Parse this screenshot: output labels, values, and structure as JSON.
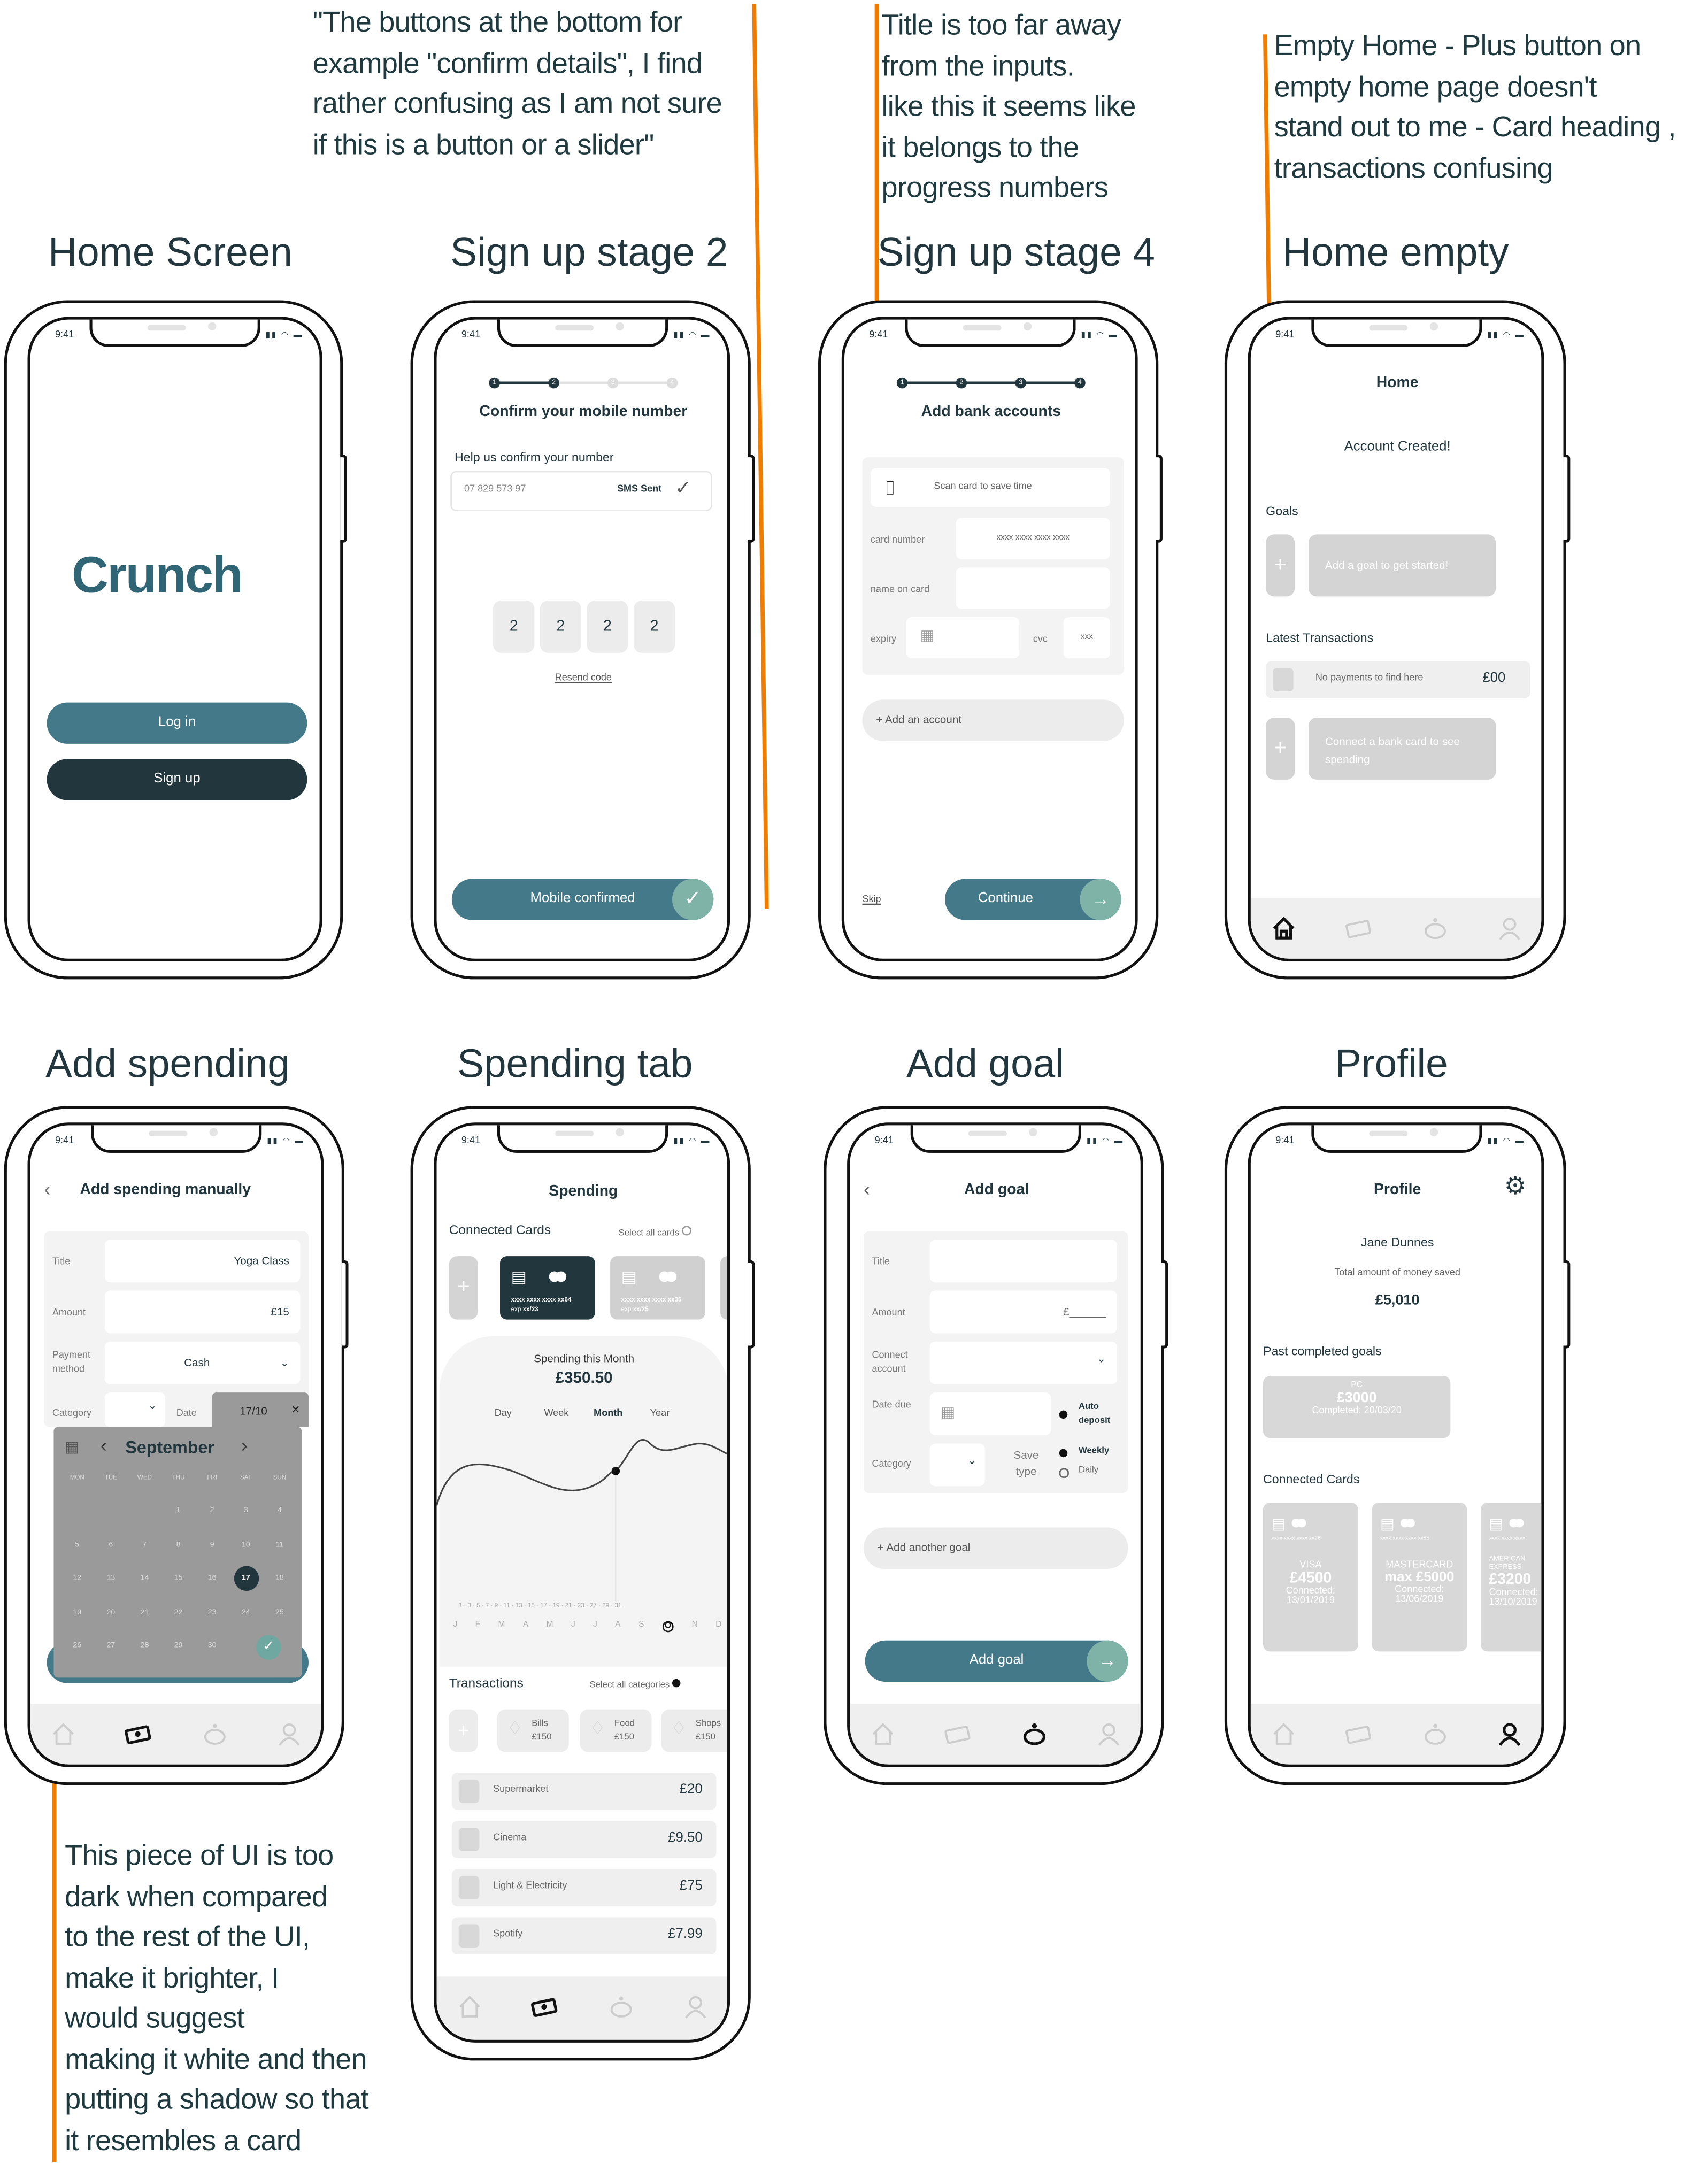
{
  "annotations": [
    {
      "lines": [
        "\"The buttons at the bottom for",
        "example \"confirm details\", I find",
        "rather confusing as I am not sure",
        "if this is a button or a slider\""
      ]
    },
    {
      "lines": [
        "Title is too far away",
        "from the inputs.",
        "like this it seems like",
        "it belongs to the",
        "progress numbers"
      ]
    },
    {
      "lines": [
        "Empty Home - Plus button on",
        "empty home page doesn't",
        "stand out to me - Card heading ,",
        "transactions confusing"
      ]
    },
    {
      "lines": [
        "This piece of UI is too",
        "dark when compared",
        "to the rest of the UI,",
        "make it brighter, I",
        "would suggest",
        "making it white and then",
        "putting a shadow so that",
        "it resembles a card"
      ]
    }
  ],
  "colors": {
    "accent": "#44798a",
    "dark": "#21363d",
    "annotation_line": "#f07d00",
    "placeholder": "#d4d4d4"
  },
  "status_time": "9:41",
  "home": {
    "title": "Home Screen",
    "logo": "Crunch",
    "login": "Log in",
    "signup": "Sign up"
  },
  "signup2": {
    "title": "Sign up stage 2",
    "steps": [
      "1",
      "2",
      "3",
      "4"
    ],
    "heading": "Confirm your mobile number",
    "help": "Help us confirm your number",
    "phone_value": "07 829 573 97",
    "sms": "SMS Sent",
    "code": [
      "2",
      "2",
      "2",
      "2"
    ],
    "resend": "Resend code",
    "button": "Mobile confirmed"
  },
  "signup4": {
    "title": "Sign up stage 4",
    "steps": [
      "1",
      "2",
      "3",
      "4"
    ],
    "heading": "Add bank accounts",
    "scan": "Scan card to save time",
    "card_number_label": "card number",
    "card_number_placeholder": "xxxx xxxx xxxx xxxx",
    "name_label": "name on card",
    "expiry_label": "expiry",
    "cvc_label": "cvc",
    "cvc_placeholder": "xxx",
    "add_account": "+ Add an account",
    "skip": "Skip",
    "continue": "Continue"
  },
  "home_empty": {
    "title": "Home empty",
    "heading": "Home",
    "created": "Account Created!",
    "goals": "Goals",
    "add_goal": "Add a goal to get started!",
    "latest": "Latest Transactions",
    "no_payments": "No payments to find here",
    "amount": "£00",
    "connect": "Connect a bank card to see spending"
  },
  "add_spending": {
    "title": "Add spending",
    "heading": "Add spending manually",
    "title_label": "Title",
    "title_value": "Yoga Class",
    "amount_label": "Amount",
    "amount_value": "£15",
    "payment_label": "Payment method",
    "payment_value": "Cash",
    "category_label": "Category",
    "date_label": "Date",
    "date_value": "17/10",
    "month": "September",
    "weekdays": [
      "MON",
      "TUE",
      "WED",
      "THU",
      "FRI",
      "SAT",
      "SUN"
    ],
    "selected_day": "17",
    "days": [
      "1",
      "2",
      "3",
      "4",
      "5",
      "6",
      "7",
      "8",
      "9",
      "10",
      "11",
      "12",
      "13",
      "14",
      "15",
      "16",
      "17",
      "18",
      "19",
      "20",
      "21",
      "22",
      "23",
      "24",
      "25",
      "26",
      "27",
      "28",
      "29",
      "30"
    ]
  },
  "spending_tab": {
    "title": "Spending tab",
    "heading": "Spending",
    "connected_cards": "Connected Cards",
    "select_all_cards": "Select all cards",
    "cards": [
      {
        "number": "xxxx xxxx xxxx xx64",
        "exp_label": "exp",
        "exp": "xx/23"
      },
      {
        "number": "xxxx xxxx xxxx xx35",
        "exp_label": "exp",
        "exp": "xx/25"
      }
    ],
    "spending_label": "Spending this Month",
    "spending_value": "£350.50",
    "periods": [
      "Day",
      "Week",
      "Month",
      "Year"
    ],
    "active_period": "Month",
    "day_ticks": "1 · 3 · 5 · 7 · 9 · 11 · 13 · 15 · 17 · 19 · 21 · 23 · 27 · 29 · 31",
    "months": [
      "J",
      "F",
      "M",
      "A",
      "M",
      "J",
      "J",
      "A",
      "S",
      "O",
      "N",
      "D"
    ],
    "transactions": "Transactions",
    "select_all_categories": "Select all categories",
    "categories": [
      {
        "name": "Bills",
        "amount": "£150"
      },
      {
        "name": "Food",
        "amount": "£150"
      },
      {
        "name": "Shops",
        "amount": "£150"
      }
    ],
    "rows": [
      {
        "name": "Supermarket",
        "amount": "£20"
      },
      {
        "name": "Cinema",
        "amount": "£9.50"
      },
      {
        "name": "Light & Electricity",
        "amount": "£75"
      },
      {
        "name": "Spotify",
        "amount": "£7.99"
      }
    ]
  },
  "add_goal": {
    "title": "Add goal",
    "heading": "Add goal",
    "title_label": "Title",
    "amount_label": "Amount",
    "amount_placeholder": "£______",
    "connect_label": "Connect account",
    "date_label": "Date due",
    "auto_deposit": "Auto deposit",
    "category_label": "Category",
    "save_type_label": "Save type",
    "weekly": "Weekly",
    "daily": "Daily",
    "add_another": "+ Add another goal",
    "button": "Add goal"
  },
  "profile": {
    "title": "Profile",
    "heading": "Profile",
    "name": "Jane Dunnes",
    "total_label": "Total amount of money saved",
    "total": "£5,010",
    "past_goals": "Past completed goals",
    "goal": {
      "name": "PC",
      "amount": "£3000",
      "completed": "Completed: 20/03/20"
    },
    "connected_cards": "Connected Cards",
    "cards": [
      {
        "number": "xxxx xxxx xxxx xx26",
        "brand": "VISA",
        "amount": "£4500",
        "connected_label": "Connected:",
        "date": "13/01/2019"
      },
      {
        "number": "xxxx xxxx xxxx xx85",
        "brand": "MASTERCARD",
        "amount": "max £5000",
        "connected_label": "Connected:",
        "date": "13/06/2019"
      },
      {
        "number": "xxxx xxxx xxxx",
        "brand": "AMERICAN EXPRESS",
        "amount": "£3200",
        "connected_label": "Connected:",
        "date": "13/10/2019"
      }
    ]
  }
}
